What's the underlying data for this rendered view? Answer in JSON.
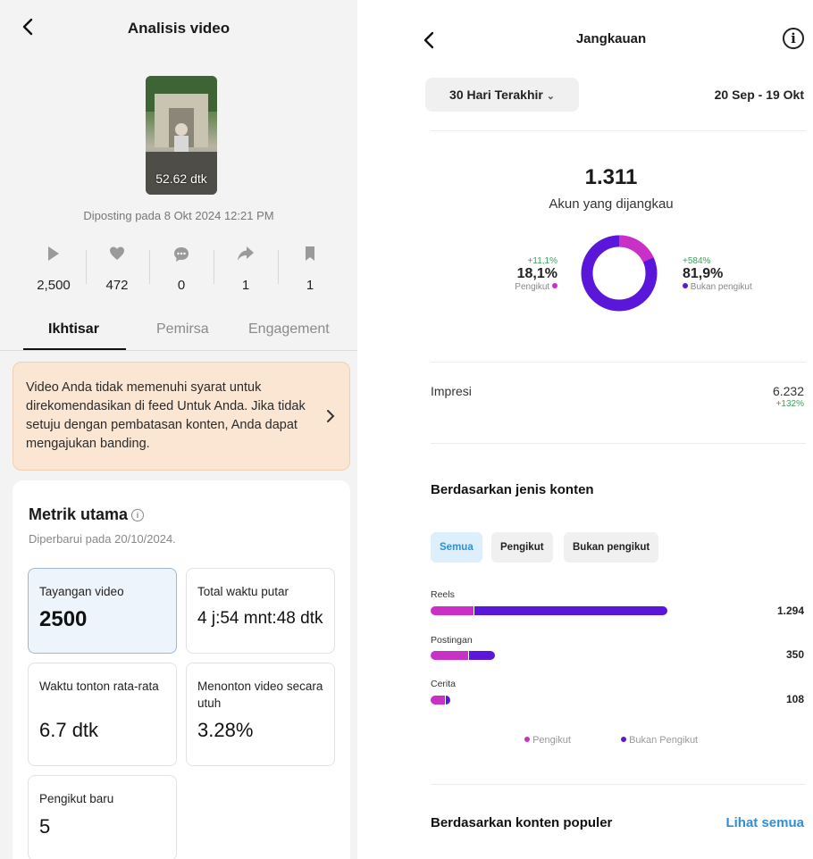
{
  "left": {
    "title": "Analisis video",
    "thumbnail": {
      "duration": "52.62 dtk"
    },
    "posted": "Diposting pada 8 Okt 2024 12:21 PM",
    "stats": [
      {
        "icon": "play-icon",
        "value": "2,500"
      },
      {
        "icon": "heart-icon",
        "value": "472"
      },
      {
        "icon": "comment-icon",
        "value": "0"
      },
      {
        "icon": "share-icon",
        "value": "1"
      },
      {
        "icon": "bookmark-icon",
        "value": "1"
      }
    ],
    "tabs": [
      "Ikhtisar",
      "Pemirsa",
      "Engagement"
    ],
    "notice": "Video Anda tidak memenuhi syarat untuk direkomendasikan di feed Untuk Anda. Jika tidak setuju dengan pembatasan konten, Anda dapat mengajukan banding.",
    "metrics": {
      "title": "Metrik utama",
      "updated": "Diperbarui pada 20/10/2024.",
      "items": [
        {
          "label": "Tayangan video",
          "value": "2500"
        },
        {
          "label": "Total waktu putar",
          "value": "4 j:54 mnt:48 dtk"
        },
        {
          "label": "Waktu tonton rata-rata",
          "value": "6.7 dtk"
        },
        {
          "label": "Menonton video secara utuh",
          "value": "3.28%"
        },
        {
          "label": "Pengikut baru",
          "value": "5"
        }
      ]
    }
  },
  "right": {
    "title": "Jangkauan",
    "range": "30 Hari Terakhir",
    "dates": "20 Sep - 19 Okt",
    "total": "1.311",
    "total_label": "Akun yang dijangkau",
    "followers": {
      "change": "+11,1%",
      "pct": "18,1%",
      "label": "Pengikut",
      "fraction": 0.181
    },
    "non_followers": {
      "change": "+584%",
      "pct": "81,9%",
      "label": "Bukan pengikut",
      "fraction": 0.819
    },
    "impressions": {
      "label": "Impresi",
      "value": "6.232",
      "change": "+132%"
    },
    "by_content_type": {
      "title": "Berdasarkan jenis konten",
      "chips": [
        "Semua",
        "Pengikut",
        "Bukan pengikut"
      ],
      "rows": [
        {
          "label": "Reels",
          "value": "1.294",
          "total": 1294,
          "follower_share": 0.18
        },
        {
          "label": "Postingan",
          "value": "350",
          "total": 350,
          "follower_share": 0.6
        },
        {
          "label": "Cerita",
          "value": "108",
          "total": 108,
          "follower_share": 0.75
        }
      ],
      "legend": [
        "Pengikut",
        "Bukan Pengikut"
      ]
    },
    "popular": {
      "title": "Berdasarkan konten populer",
      "link": "Lihat semua"
    },
    "colors": {
      "follower": "#c930c6",
      "non_follower": "#5b17d9",
      "green": "#3aa35a",
      "link": "#2f8fd8"
    }
  }
}
